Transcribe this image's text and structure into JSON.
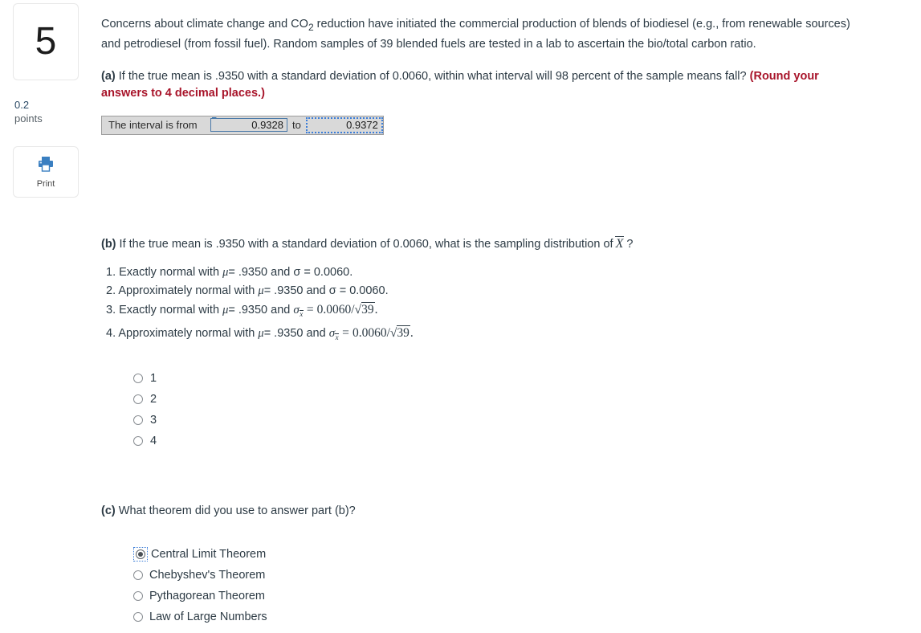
{
  "sidebar": {
    "question_number": "5",
    "points_value": "0.2",
    "points_label": "points",
    "print_label": "Print"
  },
  "question": {
    "stem": "Concerns about climate change and CO₂ reduction have initiated the commercial production of blends of biodiesel (e.g., from renewable sources) and petrodiesel (from fossil fuel). Random samples of 39 blended fuels are tested in a lab to ascertain the bio/total carbon ratio.",
    "stem_parts": {
      "before_co2": "Concerns about climate change and CO",
      "co2_sub": "2",
      "after_co2": " reduction have initiated the commercial production of blends of biodiesel (e.g., from renewable sources) and petrodiesel (from fossil fuel). Random samples of 39 blended fuels are tested in a lab to ascertain the bio/total carbon ratio."
    }
  },
  "part_a": {
    "label": "(a)",
    "text": "If the true mean is .9350 with a standard deviation of 0.0060, within what interval will 98 percent of the sample means fall?",
    "rounding_note": "(Round your answers to 4 decimal places.)",
    "rounding_note_color": "#a8142a",
    "answer_row": {
      "label": "The interval is from",
      "from_value": "0.9328",
      "connector": "to",
      "to_value": "0.9372",
      "from_placeholder": "",
      "to_placeholder": ""
    }
  },
  "part_b": {
    "label": "(b)",
    "text_before": "If the true mean is .9350 with a standard deviation of 0.0060, what is the sampling distribution of",
    "symbol": "X",
    "text_after": "?",
    "options": [
      {
        "number": "1.",
        "text": "Exactly normal with μ = .9350 and σ = 0.0060.",
        "prefix": "Exactly normal with",
        "mu": "μ",
        "mu_val": "= .9350 and",
        "sigma": "σ",
        "sigma_val": "= 0.0060."
      },
      {
        "number": "2.",
        "text": "Approximately normal with μ = .9350 and σ = 0.0060.",
        "prefix": "Approximately normal with",
        "mu": "μ",
        "mu_val": "= .9350 and",
        "sigma": "σ",
        "sigma_val": "= 0.0060."
      },
      {
        "number": "3.",
        "text": "Exactly normal with μ = .9350 and σₓ̄ = 0.0060 / √39.",
        "prefix": "Exactly normal with",
        "mu": "μ",
        "mu_val": "= .9350 and",
        "sigma_x": "σ",
        "sigma_sub": "x",
        "eq": "=",
        "num": "0.0060",
        "slash": "/",
        "root": "39",
        "period": "."
      },
      {
        "number": "4.",
        "text": "Approximately normal with μ = .9350 and σₓ̄ = 0.0060 / √39.",
        "prefix": "Approximately normal with",
        "mu": "μ",
        "mu_val": "= .9350 and",
        "sigma_x": "σ",
        "sigma_sub": "x",
        "eq": "=",
        "num": "0.0060",
        "slash": "/",
        "root": "39",
        "period": "."
      }
    ],
    "choices": [
      {
        "label": "1",
        "selected": false
      },
      {
        "label": "2",
        "selected": false
      },
      {
        "label": "3",
        "selected": false
      },
      {
        "label": "4",
        "selected": false
      }
    ]
  },
  "part_c": {
    "label": "(c)",
    "text": "What theorem did you use to answer part (b)?",
    "choices": [
      {
        "label": "Central Limit Theorem",
        "selected": true
      },
      {
        "label": "Chebyshev's Theorem",
        "selected": false
      },
      {
        "label": "Pythagorean Theorem",
        "selected": false
      },
      {
        "label": "Law of Large Numbers",
        "selected": false
      }
    ]
  },
  "colors": {
    "text": "#2d3b45",
    "accent_red": "#a8142a",
    "input_bg": "#d9d9d9",
    "focus_blue": "#3b7dd8",
    "print_blue": "#3a7fc1"
  }
}
